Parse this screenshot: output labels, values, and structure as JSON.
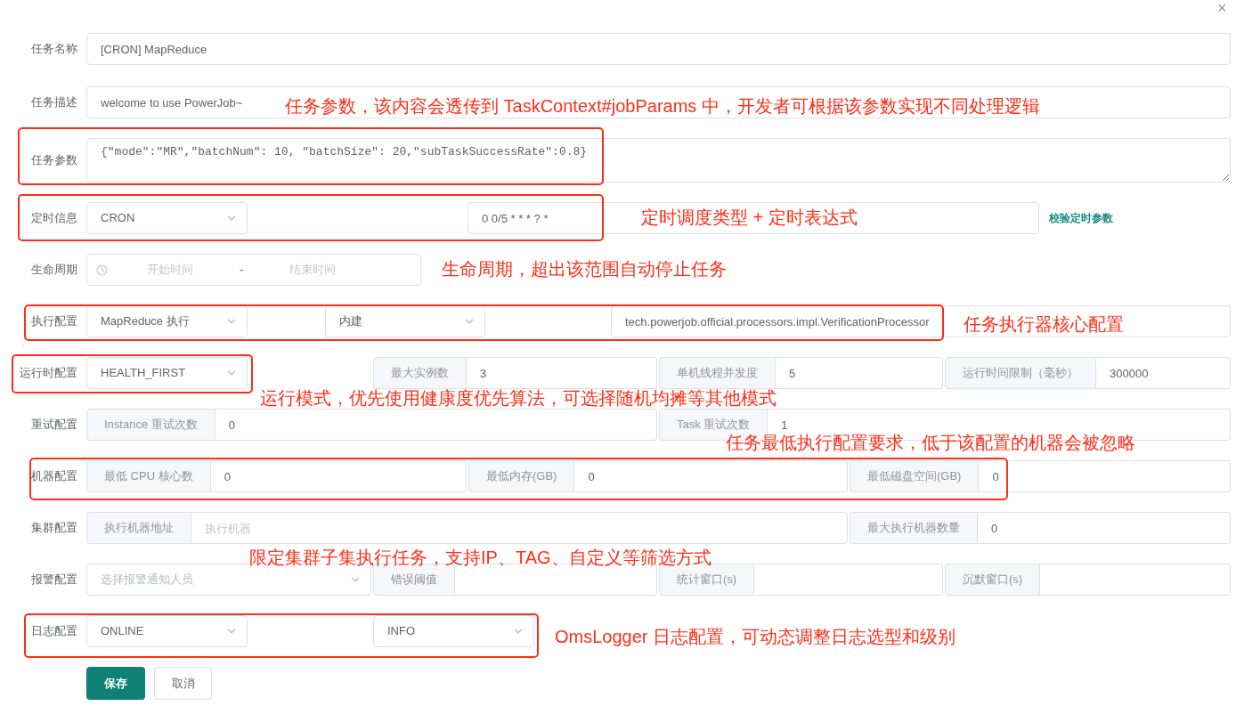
{
  "dialog": {
    "close": "×"
  },
  "form": {
    "rows": [
      {
        "label": "任务名称",
        "fields": [
          {
            "kind": "input",
            "value": "[CRON] MapReduce"
          }
        ]
      },
      {
        "label": "任务描述",
        "fields": [
          {
            "kind": "input",
            "value": "welcome to use PowerJob~"
          }
        ]
      },
      {
        "label": "任务参数",
        "fields": [
          {
            "kind": "textarea",
            "value": "{\"mode\":\"MR\",\"batchNum\": 10, \"batchSize\": 20,\"subTaskSuccessRate\":0.8}"
          }
        ]
      },
      {
        "label": "定时信息",
        "fields": [
          {
            "kind": "select",
            "value": "CRON"
          },
          {
            "kind": "input",
            "value": "0 0/5 * * * ? *"
          },
          {
            "kind": "link",
            "text": "校验定时参数"
          }
        ]
      },
      {
        "label": "生命周期",
        "fields": [
          {
            "kind": "range",
            "start_placeholder": "开始时间",
            "separator": "-",
            "end_placeholder": "结束时间"
          }
        ]
      },
      {
        "label": "执行配置",
        "fields": [
          {
            "kind": "select",
            "value": "MapReduce 执行"
          },
          {
            "kind": "select",
            "value": "内建"
          },
          {
            "kind": "input",
            "value": "tech.powerjob.official.processors.impl.VerificationProcessor"
          }
        ]
      },
      {
        "label": "运行时配置",
        "fields": [
          {
            "kind": "select",
            "value": "HEALTH_FIRST"
          },
          {
            "kind": "addon",
            "addon": "最大实例数",
            "value": "3"
          },
          {
            "kind": "addon",
            "addon": "单机线程并发度",
            "value": "5"
          },
          {
            "kind": "addon",
            "addon": "运行时间限制（毫秒）",
            "value": "300000"
          }
        ]
      },
      {
        "label": "重试配置",
        "fields": [
          {
            "kind": "addon",
            "addon": "Instance 重试次数",
            "value": "0"
          },
          {
            "kind": "addon",
            "addon": "Task 重试次数",
            "value": "1"
          }
        ]
      },
      {
        "label": "机器配置",
        "fields": [
          {
            "kind": "addon",
            "addon": "最低 CPU 核心数",
            "value": "0"
          },
          {
            "kind": "addon",
            "addon": "最低内存(GB)",
            "value": "0"
          },
          {
            "kind": "addon",
            "addon": "最低磁盘空间(GB)",
            "value": "0"
          }
        ]
      },
      {
        "label": "集群配置",
        "fields": [
          {
            "kind": "addon",
            "addon": "执行机器地址",
            "placeholder": "执行机器"
          },
          {
            "kind": "addon",
            "addon": "最大执行机器数量",
            "value": "0"
          }
        ]
      },
      {
        "label": "报警配置",
        "fields": [
          {
            "kind": "select",
            "placeholder": "选择报警通知人员"
          },
          {
            "kind": "addon",
            "addon": "错误阈值"
          },
          {
            "kind": "addon",
            "addon": "统计窗口(s)"
          },
          {
            "kind": "addon",
            "addon": "沉默窗口(s)"
          }
        ]
      },
      {
        "label": "日志配置",
        "fields": [
          {
            "kind": "select",
            "value": "ONLINE"
          },
          {
            "kind": "select",
            "value": "INFO"
          }
        ]
      }
    ],
    "buttons": [
      {
        "label": "保存",
        "kind": "primary"
      },
      {
        "label": "取消",
        "kind": "default"
      }
    ]
  },
  "annotations": [
    "任务参数，该内容会透传到 TaskContext#jobParams 中，开发者可根据该参数实现不同处理逻辑",
    "定时调度类型 + 定时表达式",
    "生命周期，超出该范围自动停止任务",
    "任务执行器核心配置",
    "运行模式，优先使用健康度优先算法，可选择随机均摊等其他模式",
    "任务最低执行配置要求，低于该配置的机器会被忽略",
    "限定集群子集执行任务，支持IP、TAG、自定义等筛选方式",
    "OmsLogger 日志配置，可动态调整日志选型和级别"
  ]
}
